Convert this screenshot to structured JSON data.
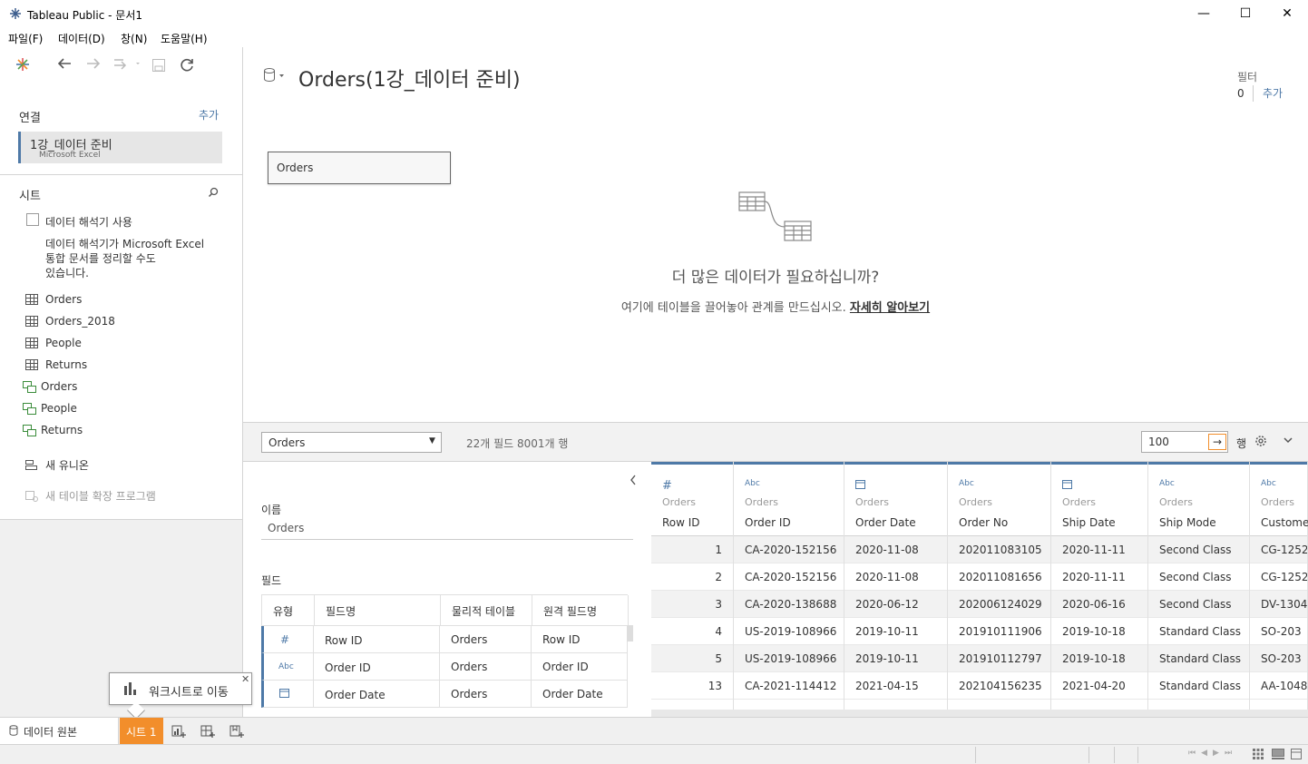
{
  "window": {
    "title": "Tableau Public - 문서1",
    "minimize": "—",
    "maximize": "☐",
    "close": "✕"
  },
  "menu": [
    "파일(F)",
    "데이터(D)",
    "창(N)",
    "도움말(H)"
  ],
  "left": {
    "connections_title": "연결",
    "add_label": "추가",
    "connection": {
      "name": "1강_데이터 준비",
      "type": "Microsoft Excel"
    },
    "sheets_title": "시트",
    "interpreter_label": "데이터 해석기 사용",
    "interpreter_desc_1": "데이터 해석기가 Microsoft Excel",
    "interpreter_desc_2": "통합 문서를 정리할 수도",
    "interpreter_desc_3": "있습니다.",
    "tables": [
      "Orders",
      "Orders_2018",
      "People",
      "Returns"
    ],
    "named_ranges": [
      "Orders",
      "People",
      "Returns"
    ],
    "new_union": "새 유니온",
    "new_extension": "새 테이블 확장 프로그램"
  },
  "canvas": {
    "title": "Orders(1강_데이터 준비)",
    "filter_label": "필터",
    "filter_count": "0",
    "filter_add": "추가",
    "table_box": "Orders",
    "more_data_title": "더 많은 데이터가 필요하십니까?",
    "more_data_desc": "여기에 테이블을 끌어놓아 관계를 만드십시오.",
    "learn_more": "자세히 알아보기"
  },
  "gridbar": {
    "table_select": "Orders",
    "summary": "22개 필드 8001개 행",
    "rows_value": "100",
    "rows_label": "행"
  },
  "meta": {
    "name_label": "이름",
    "name_value": "Orders",
    "fields_label": "필드",
    "headers": [
      "유형",
      "필드명",
      "물리적 테이블",
      "원격 필드명"
    ],
    "rows": [
      {
        "type": "#",
        "name": "Row ID",
        "table": "Orders",
        "remote": "Row ID"
      },
      {
        "type": "Abc",
        "name": "Order ID",
        "table": "Orders",
        "remote": "Order ID"
      },
      {
        "type": "date",
        "name": "Order Date",
        "table": "Orders",
        "remote": "Order Date"
      }
    ]
  },
  "grid": {
    "source": "Orders",
    "columns": [
      {
        "type": "#",
        "name": "Row ID"
      },
      {
        "type": "Abc",
        "name": "Order ID"
      },
      {
        "type": "date",
        "name": "Order Date"
      },
      {
        "type": "Abc",
        "name": "Order No"
      },
      {
        "type": "date",
        "name": "Ship Date"
      },
      {
        "type": "Abc",
        "name": "Ship Mode"
      },
      {
        "type": "Abc",
        "name": "Custome"
      }
    ],
    "rows": [
      [
        "1",
        "CA-2020-152156",
        "2020-11-08",
        "202011083105",
        "2020-11-11",
        "Second Class",
        "CG-1252"
      ],
      [
        "2",
        "CA-2020-152156",
        "2020-11-08",
        "202011081656",
        "2020-11-11",
        "Second Class",
        "CG-1252"
      ],
      [
        "3",
        "CA-2020-138688",
        "2020-06-12",
        "202006124029",
        "2020-06-16",
        "Second Class",
        "DV-1304"
      ],
      [
        "4",
        "US-2019-108966",
        "2019-10-11",
        "201910111906",
        "2019-10-18",
        "Standard Class",
        "SO-203"
      ],
      [
        "5",
        "US-2019-108966",
        "2019-10-11",
        "201910112797",
        "2019-10-18",
        "Standard Class",
        "SO-203"
      ],
      [
        "13",
        "CA-2021-114412",
        "2021-04-15",
        "202104156235",
        "2021-04-20",
        "Standard Class",
        "AA-1048"
      ]
    ]
  },
  "tooltip": {
    "text": "워크시트로 이동"
  },
  "tabs": {
    "datasource": "데이터 원본",
    "sheet1": "시트 1"
  },
  "colors": {
    "accent": "#4e79a7",
    "sheet_tab": "#f28e2b"
  }
}
